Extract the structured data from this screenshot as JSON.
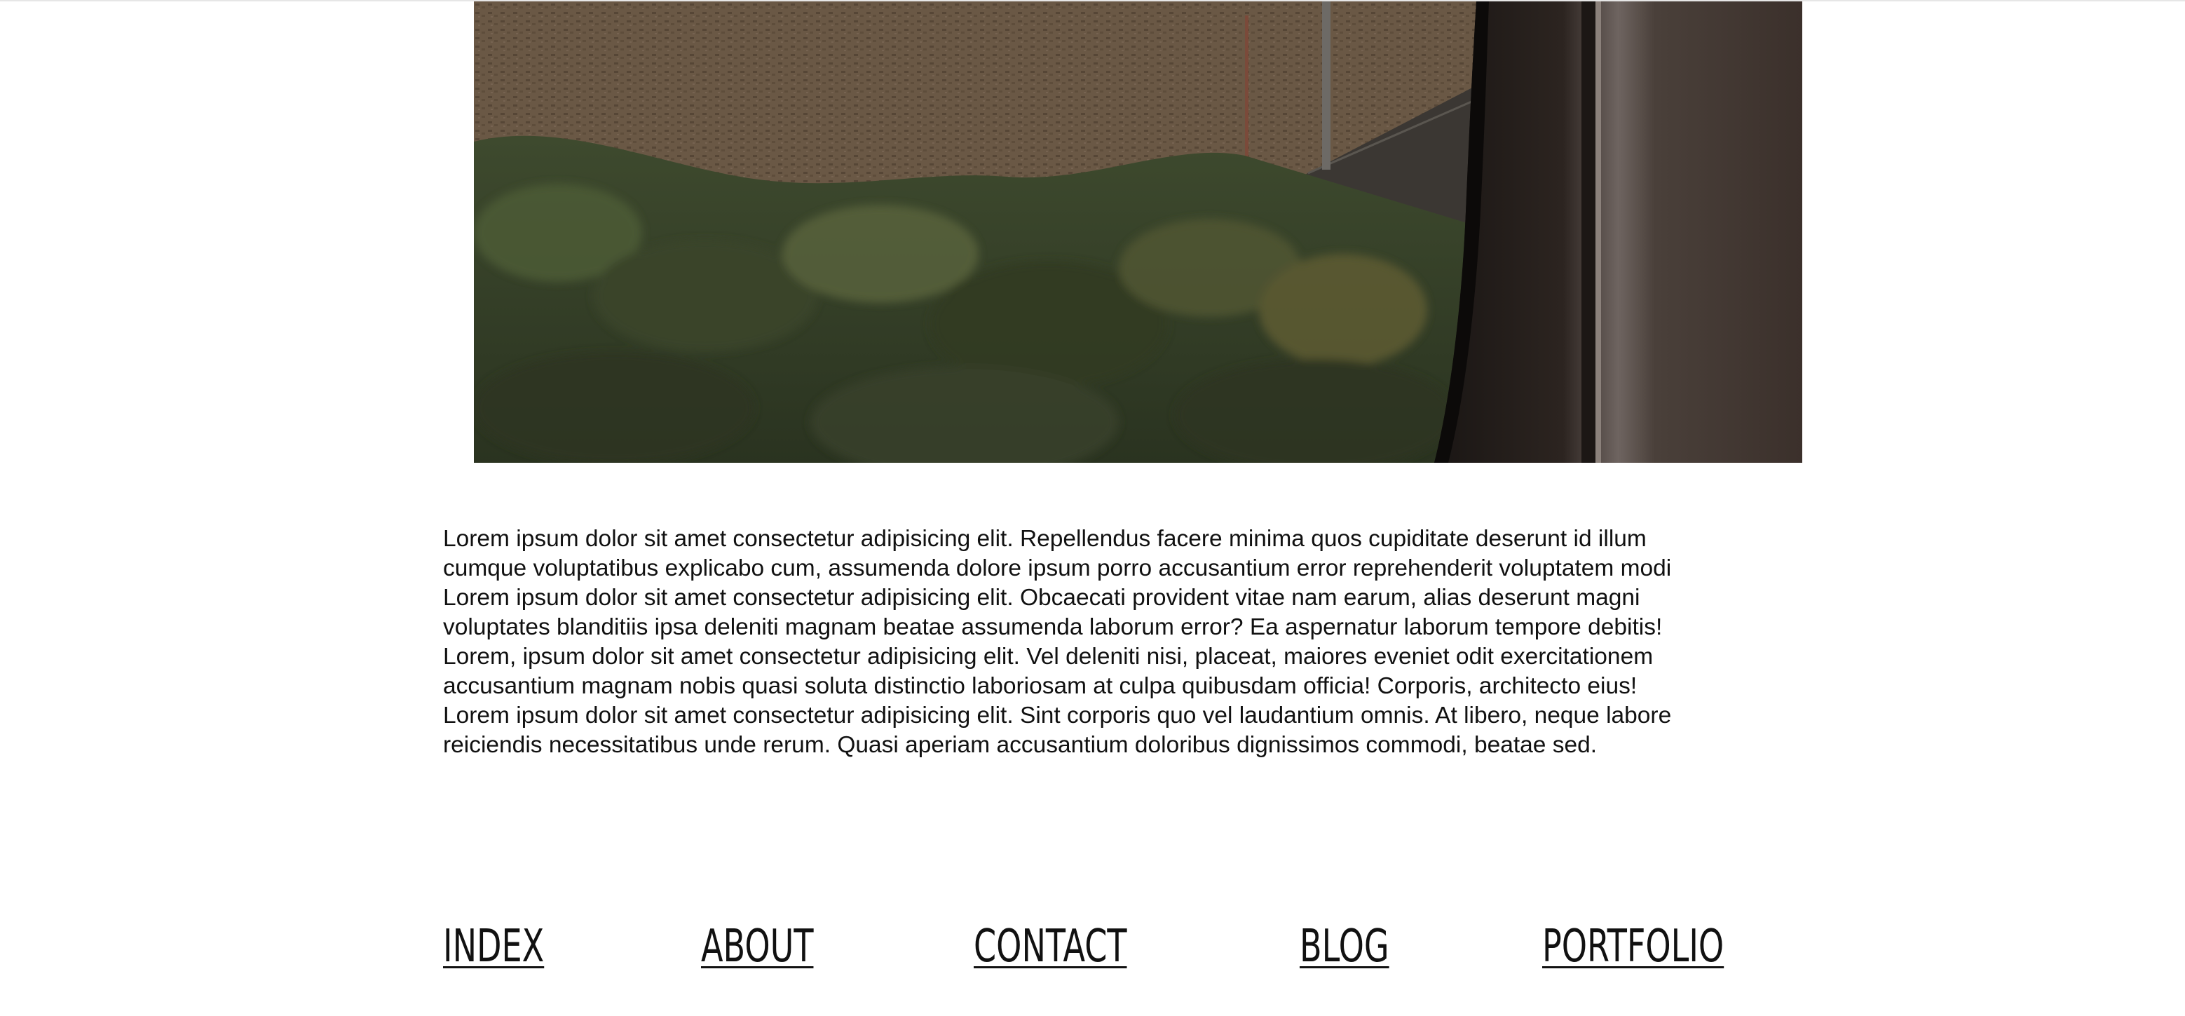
{
  "hero": {
    "icon": "photo-train-window-field"
  },
  "content": {
    "lines": [
      "Lorem ipsum dolor sit amet consectetur adipisicing elit. Repellendus facere minima quos cupiditate deserunt id illum",
      "cumque voluptatibus explicabo cum, assumenda dolore ipsum porro accusantium error reprehenderit voluptatem modi",
      "Lorem ipsum dolor sit amet consectetur adipisicing elit. Obcaecati provident vitae nam earum, alias deserunt magni",
      "voluptates blanditiis ipsa deleniti magnam beatae assumenda laborum error? Ea aspernatur laborum tempore debitis!",
      "Lorem, ipsum dolor sit amet consectetur adipisicing elit. Vel deleniti nisi, placeat, maiores eveniet odit exercitationem",
      "accusantium magnam nobis quasi soluta distinctio laboriosam at culpa quibusdam officia! Corporis, architecto eius!",
      "Lorem ipsum dolor sit amet consectetur adipisicing elit. Sint corporis quo vel laudantium omnis. At libero, neque labore",
      "reiciendis necessitatibus unde rerum. Quasi aperiam accusantium doloribus dignissimos commodi, beatae sed."
    ]
  },
  "nav": {
    "index": "INDEX",
    "about": "ABOUT",
    "contact": "CONTACT",
    "blog": "BLOG",
    "portfolio": "PORTFOLIO"
  },
  "colors": {
    "text": "#111111",
    "background": "#ffffff"
  }
}
